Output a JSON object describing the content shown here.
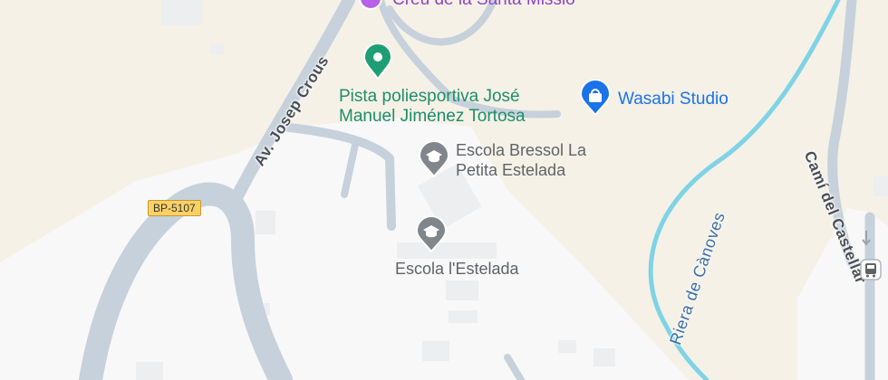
{
  "map": {
    "pois": {
      "top_cut": "Creu de la Santa Missio",
      "pista": [
        "Pista poliesportiva José",
        "Manuel Jiménez Tortosa"
      ],
      "wasabi": "Wasabi Studio",
      "bressol": [
        "Escola Bressol La",
        "Petita Estelada"
      ],
      "estelada": "Escola l'Estelada"
    },
    "roads": {
      "josep_crous": "Av. Josep Crous",
      "bp5107": "BP-5107",
      "cami_castellar": "Camí del Castellar"
    },
    "water": {
      "riera": "Riera de Cànoves"
    },
    "icons": {
      "pista": "sports-pin-icon",
      "wasabi": "shopping-bag-pin-icon",
      "school": "school-pin-icon",
      "bus": "bus-stop-icon"
    },
    "colors": {
      "land": "#f5f1e6",
      "urban": "#f8f8f8",
      "road": "#c6d1db",
      "river": "#7fd3e6",
      "green_poi": "#1e8e6a",
      "blue_poi": "#1a73e8",
      "grey_poi": "#80868b"
    }
  }
}
